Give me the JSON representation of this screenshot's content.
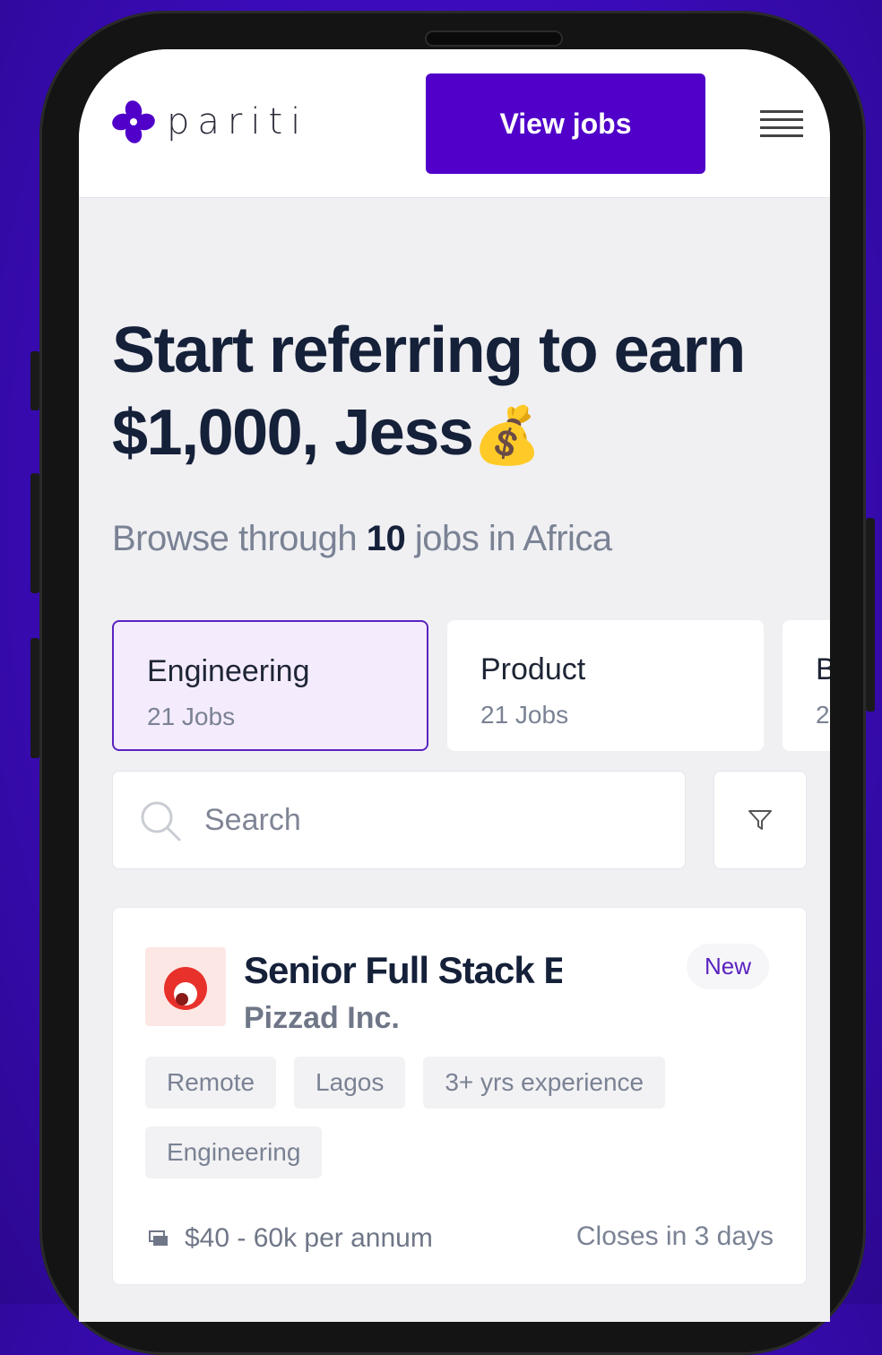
{
  "app": {
    "logo_text": "pariti",
    "view_jobs_label": "View jobs",
    "brand_color": "#5000c9"
  },
  "hero": {
    "headline": "Start referring to earn $1,000, Jess",
    "emoji": "💰",
    "subline_prefix": "Browse through ",
    "subline_count": "10",
    "subline_suffix": " jobs in Africa"
  },
  "categories": [
    {
      "name": "Engineering",
      "count": "21 Jobs",
      "active": true
    },
    {
      "name": "Product",
      "count": "21 Jobs",
      "active": false
    },
    {
      "name": "B",
      "count": "2",
      "active": false
    }
  ],
  "search": {
    "placeholder": "Search"
  },
  "job": {
    "title": "Senior Full Stack Engineer",
    "badge": "New",
    "company": "Pizzad Inc.",
    "tags": [
      "Remote",
      "Lagos",
      "3+ yrs experience",
      "Engineering"
    ],
    "salary": "$40 - 60k per annum",
    "closes": "Closes in 3 days"
  }
}
